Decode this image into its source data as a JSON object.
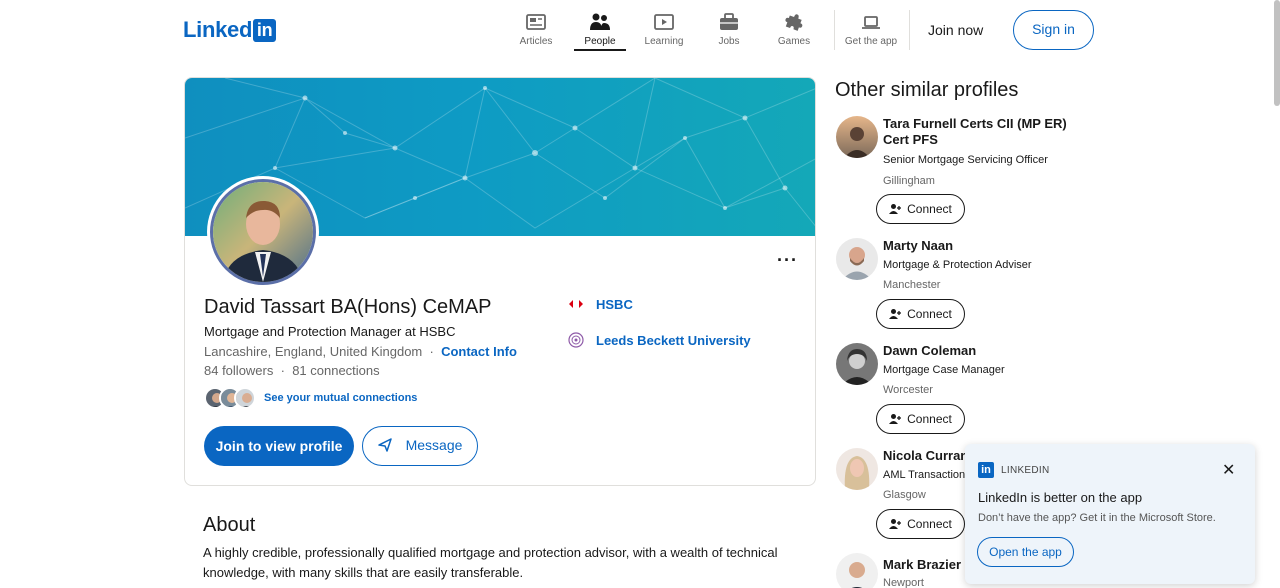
{
  "header": {
    "logo_text": "Linked",
    "logo_box": "in",
    "nav": [
      {
        "label": "Articles",
        "icon": "articles-icon"
      },
      {
        "label": "People",
        "icon": "people-icon",
        "active": true
      },
      {
        "label": "Learning",
        "icon": "learning-icon"
      },
      {
        "label": "Jobs",
        "icon": "jobs-icon"
      },
      {
        "label": "Games",
        "icon": "games-icon"
      },
      {
        "label": "Get the app",
        "icon": "laptop-icon"
      }
    ],
    "join_now": "Join now",
    "sign_in": "Sign in"
  },
  "profile": {
    "name": "David Tassart BA(Hons) CeMAP",
    "headline": "Mortgage and Protection Manager at HSBC",
    "location": "Lancashire, England, United Kingdom",
    "separator": "·",
    "contact_info": "Contact Info",
    "followers": "84 followers",
    "connections": "81 connections",
    "mutual_label": "See your mutual connections",
    "join_button": "Join to view profile",
    "message_button": "Message",
    "more_menu": "···",
    "company": "HSBC",
    "school": "Leeds Beckett University"
  },
  "about": {
    "title": "About",
    "text": "A highly credible, professionally qualified mortgage and protection advisor, with a wealth of technical knowledge, with many skills that are easily transferable."
  },
  "sidebar": {
    "title": "Other similar profiles",
    "connect_label": "Connect",
    "people": [
      {
        "name": "Tara Furnell Certs CII (MP ER) Cert PFS",
        "title": "Senior Mortgage Servicing Officer",
        "location": "Gillingham"
      },
      {
        "name": "Marty Naan",
        "title": "Mortgage & Protection Adviser",
        "location": "Manchester"
      },
      {
        "name": "Dawn Coleman",
        "title": "Mortgage Case Manager",
        "location": "Worcester"
      },
      {
        "name": "Nicola Curran Cert CII (MP)",
        "title": "AML Transaction Monitoring Analyst",
        "location": "Glasgow"
      },
      {
        "name": "Mark Brazier",
        "title": "",
        "location": "Newport"
      }
    ]
  },
  "popup": {
    "brand": "LINKEDIN",
    "title": "LinkedIn is better on the app",
    "subtitle": "Don’t have the app? Get it in the Microsoft Store.",
    "button": "Open the app",
    "close": "✕"
  },
  "colors": {
    "brand": "#0a66c2",
    "banner": "#0f8fbf"
  }
}
